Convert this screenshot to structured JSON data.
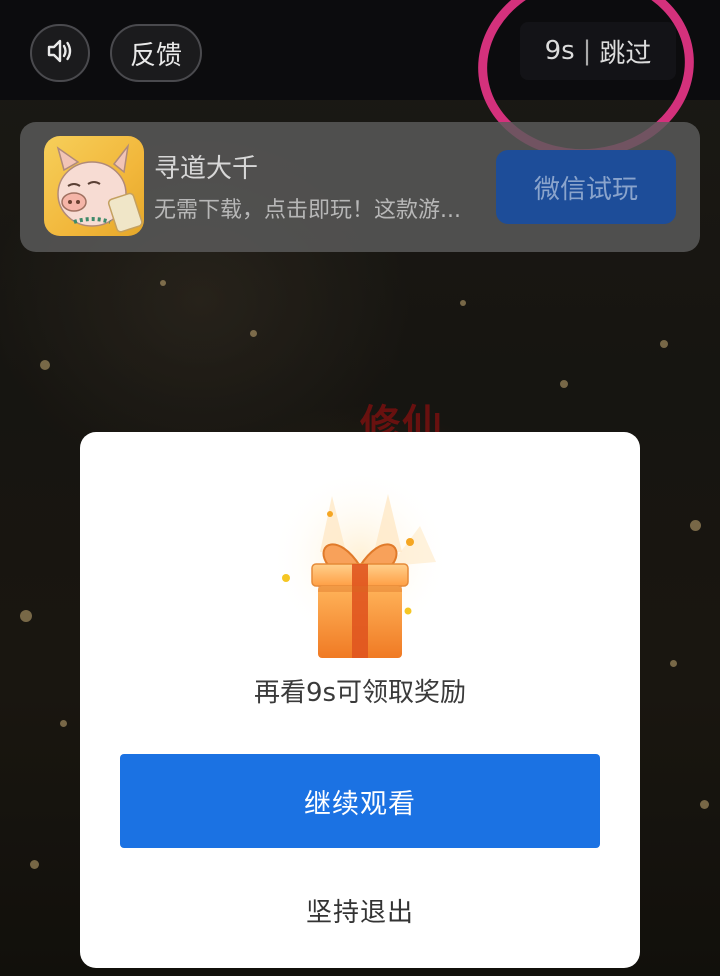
{
  "topbar": {
    "sound_icon": "speaker-icon",
    "feedback_label": "反馈",
    "countdown": "9s",
    "separator": "|",
    "skip_label": "跳过"
  },
  "ad": {
    "app_name": "寻道大千",
    "description": "无需下载，点击即玩！这款游...",
    "cta_label": "微信试玩",
    "icon": "pig-character-app-icon"
  },
  "background": {
    "overlay_text": "修仙"
  },
  "dialog": {
    "icon": "gift-box-icon",
    "message": "再看9s可领取奖励",
    "primary_label": "继续观看",
    "secondary_label": "坚持退出"
  },
  "colors": {
    "primary_button": "#1b72e3",
    "highlight_ring": "#d4317c",
    "cta_button": "#1d4d99"
  }
}
